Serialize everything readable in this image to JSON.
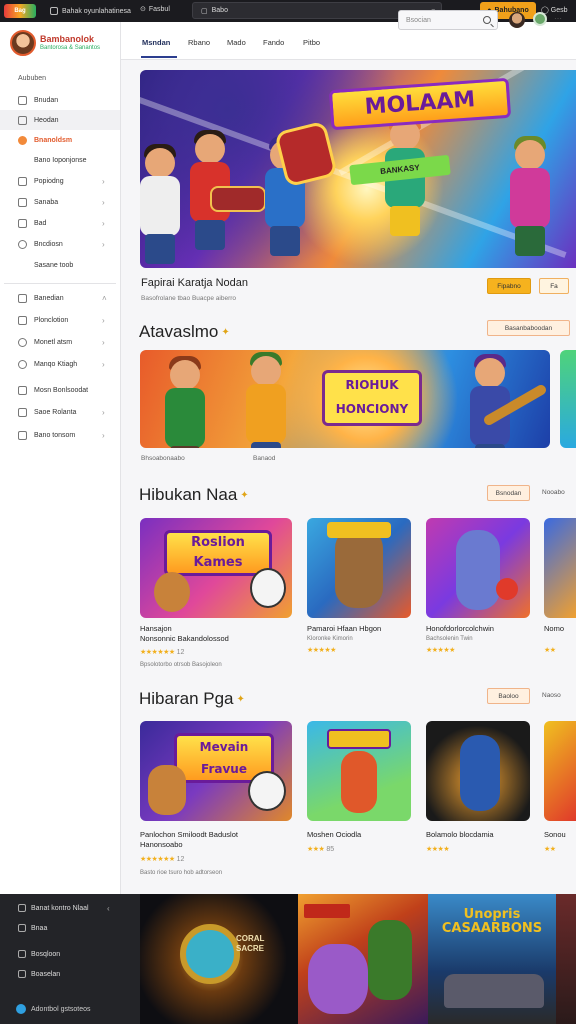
{
  "topbar": {
    "logo": "Bag",
    "tab_label": "Bahak oyunlahatinesa",
    "tab2_label": "Fasbul",
    "address": "Babo",
    "button_label": "Bahubano",
    "user_label": "Gesb"
  },
  "sidebar": {
    "brand_title": "Bambanolok",
    "brand_sub": "Bantorosa & Sanantos",
    "section_head": "Aububen",
    "items": [
      {
        "label": "Bnudan"
      },
      {
        "label": "Heodan"
      },
      {
        "label": "Bnanoldsm"
      },
      {
        "label": "Bano Ioponjonse"
      },
      {
        "label": "Popiodng"
      },
      {
        "label": "Sanaba"
      },
      {
        "label": "Bad"
      },
      {
        "label": "Bncdiosn"
      },
      {
        "label": "Sasane toob"
      },
      {
        "label": "Banedian"
      },
      {
        "label": "Plonclotion"
      },
      {
        "label": "Monetl atsm"
      },
      {
        "label": "Manqo Ktiagh"
      },
      {
        "label": "Mosn Bonlsoodat"
      },
      {
        "label": "Saoe Rolanta"
      },
      {
        "label": "Bano tonsom"
      }
    ]
  },
  "nav": {
    "tabs": [
      "Msndan",
      "Rbano",
      "Mado",
      "Fando",
      "Pitbo"
    ],
    "search_placeholder": "Bsocian"
  },
  "hero": {
    "title": "MOLAAM",
    "subtitle": "BANKASY",
    "caption": "Fapirai Karatja Nodan",
    "subcaption": "Basofrolane tbao Buacpe aiberro",
    "btn_primary": "Fipabno",
    "btn_secondary": "Fa"
  },
  "section1": {
    "title": "Atavaslmo",
    "pill": "Basanbaboodan",
    "banner_title": "RIOHUK HONCIONY",
    "caption_left": "Bhsoabonaabo",
    "caption_right": "Banaod"
  },
  "section2": {
    "title": "Hibukan Naa",
    "pill": "Bsnodan",
    "more": "Nooabo",
    "cards": [
      {
        "logo": "Roslion Kames",
        "title": "Hansajon\nNonsonnic Bakandolossod",
        "stars": "★★★★★★",
        "count": "12",
        "meta": "Bpsolotorbo otrsob Basojoleon"
      },
      {
        "logo": "",
        "title": "Pamaroi Hfaan Hbgon",
        "stars": "★★★★★",
        "count": "",
        "meta": "",
        "sub": "Kloronke Kimorin"
      },
      {
        "logo": "",
        "title": "Honofdorlorcolchwin",
        "stars": "★★★★★",
        "count": "",
        "meta": "",
        "sub": "Bachsolenin Twin"
      },
      {
        "logo": "",
        "title": "Nomo",
        "stars": "★★",
        "count": "",
        "meta": ""
      }
    ]
  },
  "section3": {
    "title": "Hibaran Pga",
    "pill": "Baoloo",
    "more": "Naoso",
    "cards": [
      {
        "logo": "Mevain Fravue",
        "title": "Panlochon Smiloodt Baduslot\nHanonsoabo",
        "stars": "★★★★★★",
        "count": "12",
        "meta": "Basto rioe tsuro hob adtorseon"
      },
      {
        "logo": "",
        "title": "Moshen Ociodla",
        "stars": "★★★",
        "count": "85",
        "meta": ""
      },
      {
        "logo": "",
        "title": "Bolamolo blocdamia",
        "stars": "★★★★",
        "count": "",
        "meta": ""
      },
      {
        "logo": "",
        "title": "Sonou",
        "stars": "★★",
        "count": "",
        "meta": ""
      }
    ]
  },
  "footer": {
    "items": [
      {
        "label": "Banat kontro Nlaal"
      },
      {
        "label": "Bnaa"
      },
      {
        "label": "Bosqloon"
      },
      {
        "label": "Boaselan"
      }
    ],
    "bottom_label": "Adontbol gstsoteos",
    "tile1": "CORAL SACRE",
    "tile3": "Unopris CASAARBONS"
  }
}
